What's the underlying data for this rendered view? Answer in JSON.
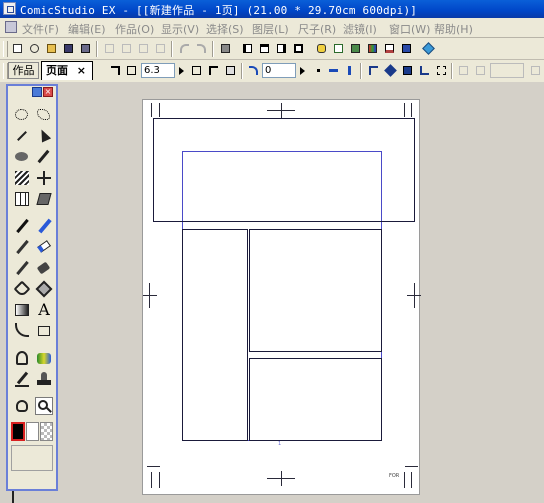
{
  "window": {
    "title": "ComicStudio EX - [[新建作品 - 1页] (21.00 * 29.70cm 600dpi)]"
  },
  "menu": {
    "items": [
      "文件(F)",
      "编辑(E)",
      "作品(O)",
      "显示(V)",
      "选择(S)",
      "图层(L)",
      "尺子(R)",
      "滤镜(I)",
      "窗口(W)",
      "帮助(H)"
    ]
  },
  "toolbar2": {
    "tab_work": "作品",
    "tab_page": "页面",
    "tab_close": "×",
    "zoom_value": "6.3",
    "rotate_value": "0"
  },
  "colors": {
    "title_bar": "#0046c8",
    "palette_border": "#6a7fd8",
    "frame_line": "#1a1a3a",
    "basic_frame": "#4a4ac8",
    "workspace": "#d4d0c8",
    "foreground_color": "#000000",
    "background_color": "#ffffff"
  },
  "page": {
    "page_number": "1",
    "corner_label": "FOR"
  }
}
